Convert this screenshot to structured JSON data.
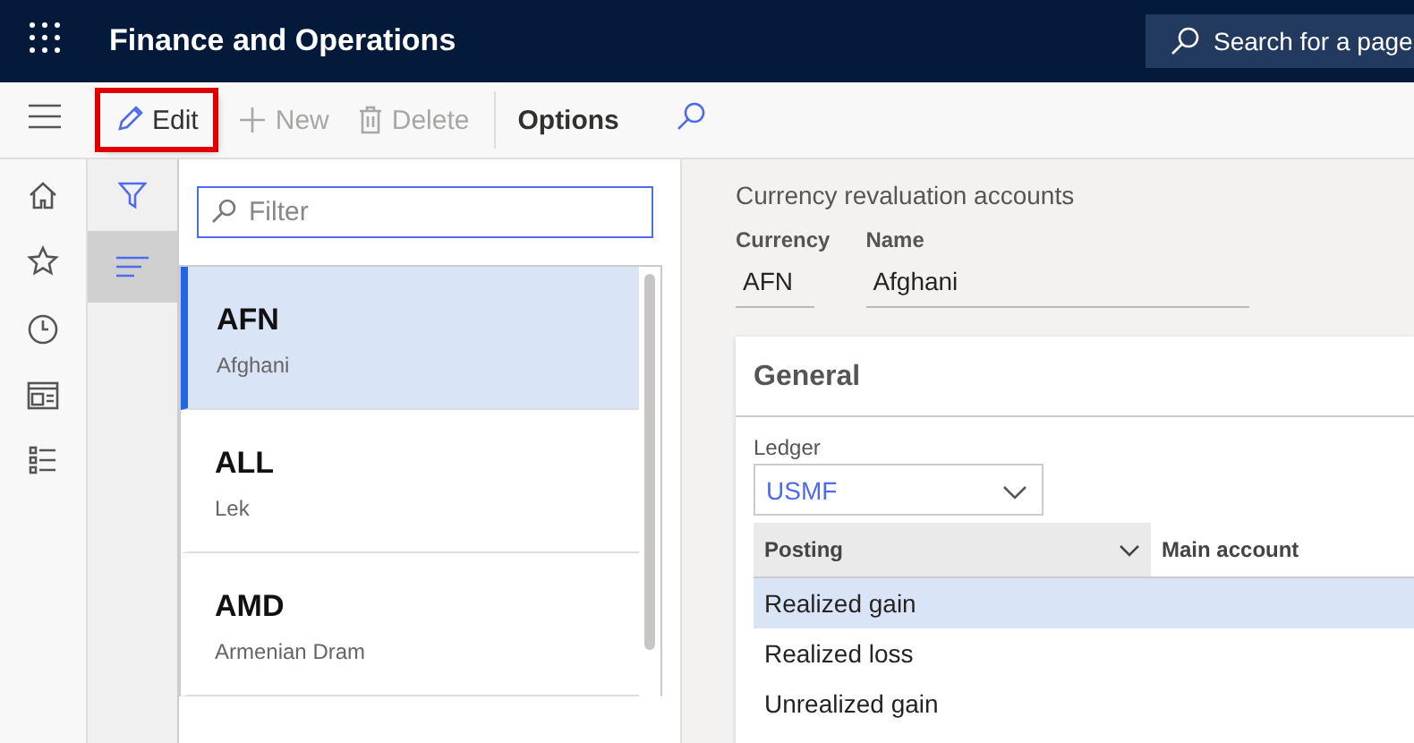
{
  "app_bar": {
    "title": "Finance and Operations",
    "search": {
      "label": "Search for a page"
    }
  },
  "toolbar": {
    "buttons": [
      {
        "kind": "edit",
        "label": "Edit",
        "disabled": false,
        "highlighted": true
      },
      {
        "kind": "new",
        "label": "New",
        "disabled": true,
        "highlighted": false
      },
      {
        "kind": "delete",
        "label": "Delete",
        "disabled": true,
        "highlighted": false
      },
      {
        "kind": "options",
        "label": "Options",
        "disabled": false,
        "highlighted": false
      }
    ]
  },
  "filter_rail": {
    "items": [
      {
        "kind": "filter",
        "selected": false
      },
      {
        "kind": "list",
        "selected": true
      }
    ]
  },
  "list_pane": {
    "filter": {
      "placeholder": "Filter"
    },
    "items": [
      {
        "code": "AFN",
        "name": "Afghani",
        "selected": true
      },
      {
        "code": "ALL",
        "name": "Lek",
        "selected": false
      },
      {
        "code": "AMD",
        "name": "Armenian Dram",
        "selected": false
      }
    ]
  },
  "details": {
    "title": "Currency revaluation accounts",
    "fields": [
      {
        "label": "Currency",
        "value": "AFN"
      },
      {
        "label": "Name",
        "value": "Afghani"
      }
    ],
    "general": {
      "title": "General",
      "ledger": {
        "label": "Ledger",
        "value": "USMF"
      },
      "columns": [
        {
          "label": "Posting",
          "selected": true
        },
        {
          "label": "Main account",
          "selected": false
        }
      ],
      "rows": [
        {
          "posting": "Realized gain",
          "selected": true
        },
        {
          "posting": "Realized loss",
          "selected": false
        },
        {
          "posting": "Unrealized gain",
          "selected": false
        }
      ]
    }
  }
}
